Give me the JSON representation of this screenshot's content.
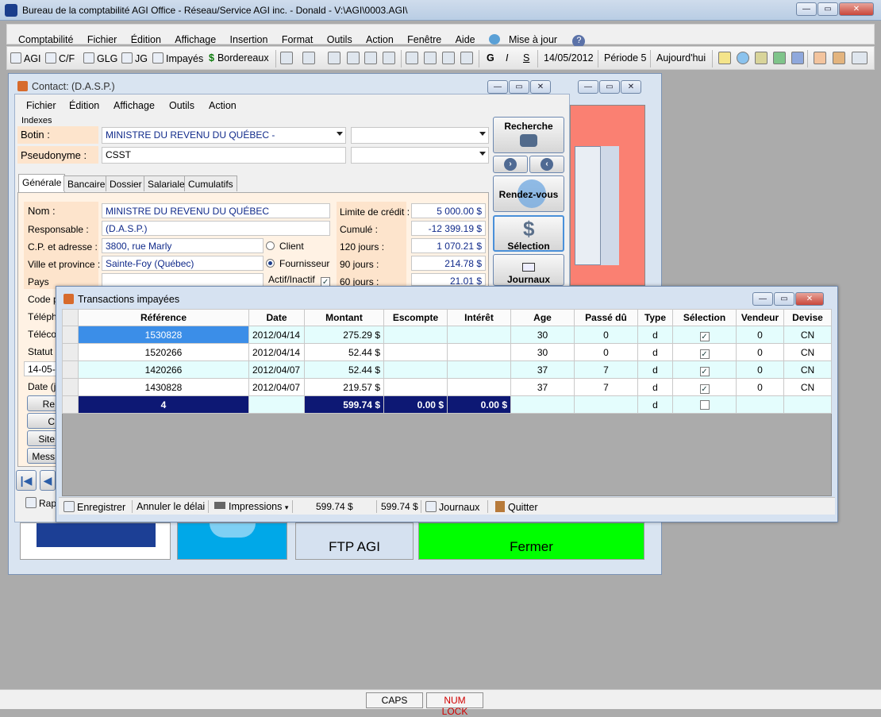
{
  "app": {
    "title": "Bureau de la comptabilité AGI Office - Réseau/Service AGI inc. - Donald - V:\\AGI\\0003.AGI\\",
    "menu": [
      "Comptabilité",
      "Fichier",
      "Édition",
      "Affichage",
      "Insertion",
      "Format",
      "Outils",
      "Action",
      "Fenêtre",
      "Aide",
      "Mise à jour"
    ],
    "toolbar": {
      "agi": "AGI",
      "cf": "C/F",
      "glg": "GLG",
      "jg": "JG",
      "impayes": "Impayés",
      "bordereaux": "Bordereaux",
      "bold": "G",
      "italic": "I",
      "underline": "S",
      "date": "14/05/2012",
      "periode": "Période 5",
      "today": "Aujourd'hui"
    }
  },
  "contact": {
    "title": "Contact: (D.A.S.P.)",
    "menu": [
      "Fichier",
      "Édition",
      "Affichage",
      "Outils",
      "Action"
    ],
    "indexes_label": "Indexes",
    "botin_label": "Botin :",
    "botin_value": "MINISTRE DU REVENU DU QUÉBEC  -",
    "pseudonyme_label": "Pseudonyme :",
    "pseudonyme_value": "CSST",
    "tabs": [
      "Générale",
      "Bancaire",
      "Dossier",
      "Salariale",
      "Cumulatifs"
    ],
    "fields": {
      "nom_label": "Nom :",
      "nom": "MINISTRE DU REVENU DU QUÉBEC",
      "resp_label": "Responsable :",
      "resp": "(D.A.S.P.)",
      "adresse_label": "C.P. et adresse :",
      "adresse": "3800, rue Marly",
      "ville_label": "Ville et province :",
      "ville": "Sainte-Foy (Québec)",
      "pays_label": "Pays",
      "code_label": "Code p",
      "tel_label": "Téléph",
      "telec_label": "Télécop",
      "statut_label": "Statut :",
      "date_value": "14-05-2",
      "date_label": "Date (j",
      "client_label": "Client",
      "fournisseur_label": "Fournisseur",
      "actif_label": "Actif/Inactif"
    },
    "credit": [
      {
        "label": "Limite de crédit :",
        "value": "5 000.00 $"
      },
      {
        "label": "Cumulé :",
        "value": "-12 399.19 $"
      },
      {
        "label": "120 jours :",
        "value": "1 070.21 $"
      },
      {
        "label": "90 jours :",
        "value": "214.78 $"
      },
      {
        "label": "60 jours :",
        "value": "21.01 $"
      }
    ],
    "side_buttons": {
      "recherche": "Recherche",
      "rendezvous": "Rendez-vous",
      "selection": "Sélection",
      "journaux": "Journaux"
    },
    "small_buttons": [
      "Re",
      "C",
      "Site",
      "Mess"
    ],
    "rapport": "Rap"
  },
  "tiles": {
    "ftp": "FTP AGI",
    "fermer": "Fermer"
  },
  "transactions": {
    "title": "Transactions impayées",
    "columns": [
      "Référence",
      "Date",
      "Montant",
      "Escompte",
      "Intérêt",
      "Age",
      "Passé dû",
      "Type",
      "Sélection",
      "Vendeur",
      "Devise"
    ],
    "rows": [
      {
        "ref": "1530828",
        "date": "2012/04/14",
        "montant": "275.29 $",
        "escompte": "",
        "interet": "",
        "age": "30",
        "passe": "0",
        "type": "d",
        "sel": "✓",
        "vendeur": "0",
        "devise": "CN"
      },
      {
        "ref": "1520266",
        "date": "2012/04/14",
        "montant": "52.44 $",
        "escompte": "",
        "interet": "",
        "age": "30",
        "passe": "0",
        "type": "d",
        "sel": "✓",
        "vendeur": "0",
        "devise": "CN"
      },
      {
        "ref": "1420266",
        "date": "2012/04/07",
        "montant": "52.44 $",
        "escompte": "",
        "interet": "",
        "age": "37",
        "passe": "7",
        "type": "d",
        "sel": "✓",
        "vendeur": "0",
        "devise": "CN"
      },
      {
        "ref": "1430828",
        "date": "2012/04/07",
        "montant": "219.57 $",
        "escompte": "",
        "interet": "",
        "age": "37",
        "passe": "7",
        "type": "d",
        "sel": "✓",
        "vendeur": "0",
        "devise": "CN"
      }
    ],
    "total": {
      "count": "4",
      "montant": "599.74 $",
      "escompte": "0.00 $",
      "interet": "0.00 $",
      "type": "d"
    },
    "status": {
      "enregistrer": "Enregistrer",
      "annuler": "Annuler le délai",
      "impressions": "Impressions",
      "total1": "599.74 $",
      "total2": "599.74 $",
      "journaux": "Journaux",
      "quitter": "Quitter"
    }
  },
  "statusbar": {
    "caps": "CAPS",
    "numlock": "NUM LOCK"
  },
  "colors": {
    "accent_selected": "#3b8ee8",
    "total_row": "#0d1874",
    "row_alt": "#e4fdfd",
    "tile_green": "#00ff00",
    "tile_blue": "#00a8e8"
  }
}
